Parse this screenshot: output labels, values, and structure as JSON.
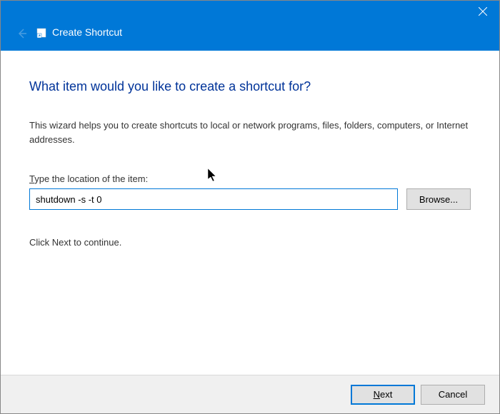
{
  "titlebar": {
    "title": "Create Shortcut"
  },
  "content": {
    "heading": "What item would you like to create a shortcut for?",
    "description": "This wizard helps you to create shortcuts to local or network programs, files, folders, computers, or Internet addresses.",
    "field_label_prefix": "T",
    "field_label_rest": "ype the location of the item:",
    "location_value": "shutdown -s -t 0",
    "browse_label": "Browse...",
    "instruction": "Click Next to continue."
  },
  "footer": {
    "next_label": "Next",
    "cancel_label": "Cancel"
  }
}
